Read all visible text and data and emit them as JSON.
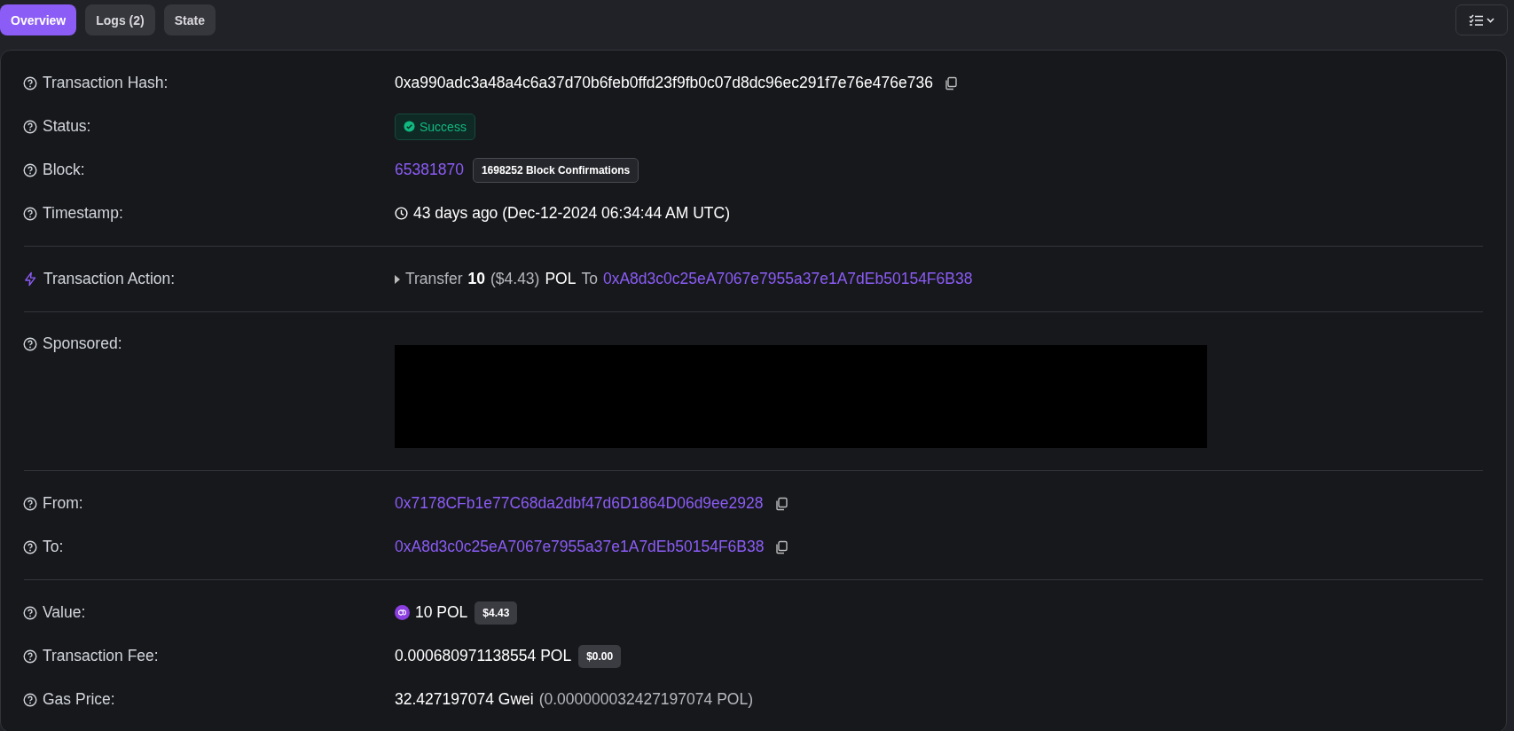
{
  "tabs": [
    {
      "label": "Overview",
      "selected": true
    },
    {
      "label": "Logs (2)",
      "selected": false
    },
    {
      "label": "State",
      "selected": false
    }
  ],
  "sections": [
    {
      "rows": [
        {
          "kind": "hash",
          "label": "Transaction Hash:",
          "value": "0xa990adc3a48a4c6a37d70b6feb0ffd23f9fb0c07d8dc96ec291f7e76e476e736"
        },
        {
          "kind": "status",
          "label": "Status:",
          "value": "Success"
        },
        {
          "kind": "block",
          "label": "Block:",
          "value": "65381870",
          "badge": "1698252 Block Confirmations"
        },
        {
          "kind": "timestamp",
          "label": "Timestamp:",
          "value": "43 days ago (Dec-12-2024 06:34:44 AM UTC)"
        }
      ]
    },
    {
      "rows": [
        {
          "kind": "action",
          "label": "Transaction Action:",
          "verb": "Transfer",
          "amount": "10",
          "usd": "($4.43)",
          "token": "POL",
          "preposition": "To",
          "address": "0xA8d3c0c25eA7067e7955a37e1A7dEb50154F6B38"
        }
      ]
    },
    {
      "rows": [
        {
          "kind": "sponsored",
          "label": "Sponsored:"
        }
      ]
    },
    {
      "rows": [
        {
          "kind": "address",
          "label": "From:",
          "value": "0x7178CFb1e77C68da2dbf47d6D1864D06d9ee2928"
        },
        {
          "kind": "address",
          "label": "To:",
          "value": "0xA8d3c0c25eA7067e7955a37e1A7dEb50154F6B38"
        }
      ]
    },
    {
      "rows": [
        {
          "kind": "amount",
          "label": "Value:",
          "token_icon": true,
          "value": "10 POL",
          "badge": "$4.43"
        },
        {
          "kind": "amount",
          "label": "Transaction Fee:",
          "token_icon": false,
          "value": "0.000680971138554 POL",
          "badge": "$0.00"
        },
        {
          "kind": "gas",
          "label": "Gas Price:",
          "value": "32.427197074 Gwei",
          "note": "(0.000000032427197074 POL)"
        }
      ]
    }
  ]
}
